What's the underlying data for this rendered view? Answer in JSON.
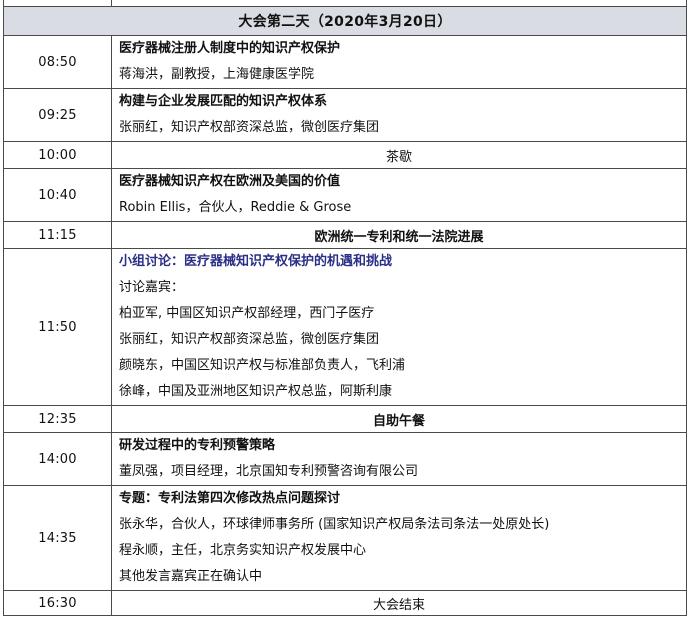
{
  "day_header": "大会第二天（2020年3月20日）",
  "sessions": [
    {
      "time": "08:50",
      "title": "医疗器械注册人制度中的知识产权保护",
      "speaker": "蒋海洪，副教授，上海健康医学院"
    },
    {
      "time": "09:25",
      "title": "构建与企业发展匹配的知识产权体系",
      "speaker": "张丽红，知识产权部资深总监，微创医疗集团"
    },
    {
      "time": "10:00",
      "title": "茶歇"
    },
    {
      "time": "10:40",
      "title": "医疗器械知识产权在欧洲及美国的价值",
      "speaker": "Robin Ellis，合伙人，Reddie & Grose"
    },
    {
      "time": "11:15",
      "title": "欧洲统一专利和统一法院进展"
    },
    {
      "time": "11:50",
      "title": "小组讨论：医疗器械知识产权保护的机遇和挑战",
      "lines": [
        "讨论嘉宾：",
        "柏亚军, 中国区知识产权部经理，西门子医疗",
        "张丽红，知识产权部资深总监，微创医疗集团",
        "颜晓东，中国区知识产权与标准部负责人，飞利浦",
        "徐峰，中国及亚洲地区知识产权总监，阿斯利康"
      ]
    },
    {
      "time": "12:35",
      "title": "自助午餐"
    },
    {
      "time": "14:00",
      "title": "研发过程中的专利预警策略",
      "speaker": "董凤强，项目经理，北京国知专利预警咨询有限公司"
    },
    {
      "time": "14:35",
      "title": "专题：专利法第四次修改热点问题探讨",
      "lines": [
        "张永华，合伙人，环球律师事务所 (国家知识产权局条法司条法一处原处长)",
        "程永顺，主任，北京务实知识产权发展中心",
        "其他发言嘉宾正在确认中"
      ]
    },
    {
      "time": "16:30",
      "title": "大会结束"
    }
  ]
}
